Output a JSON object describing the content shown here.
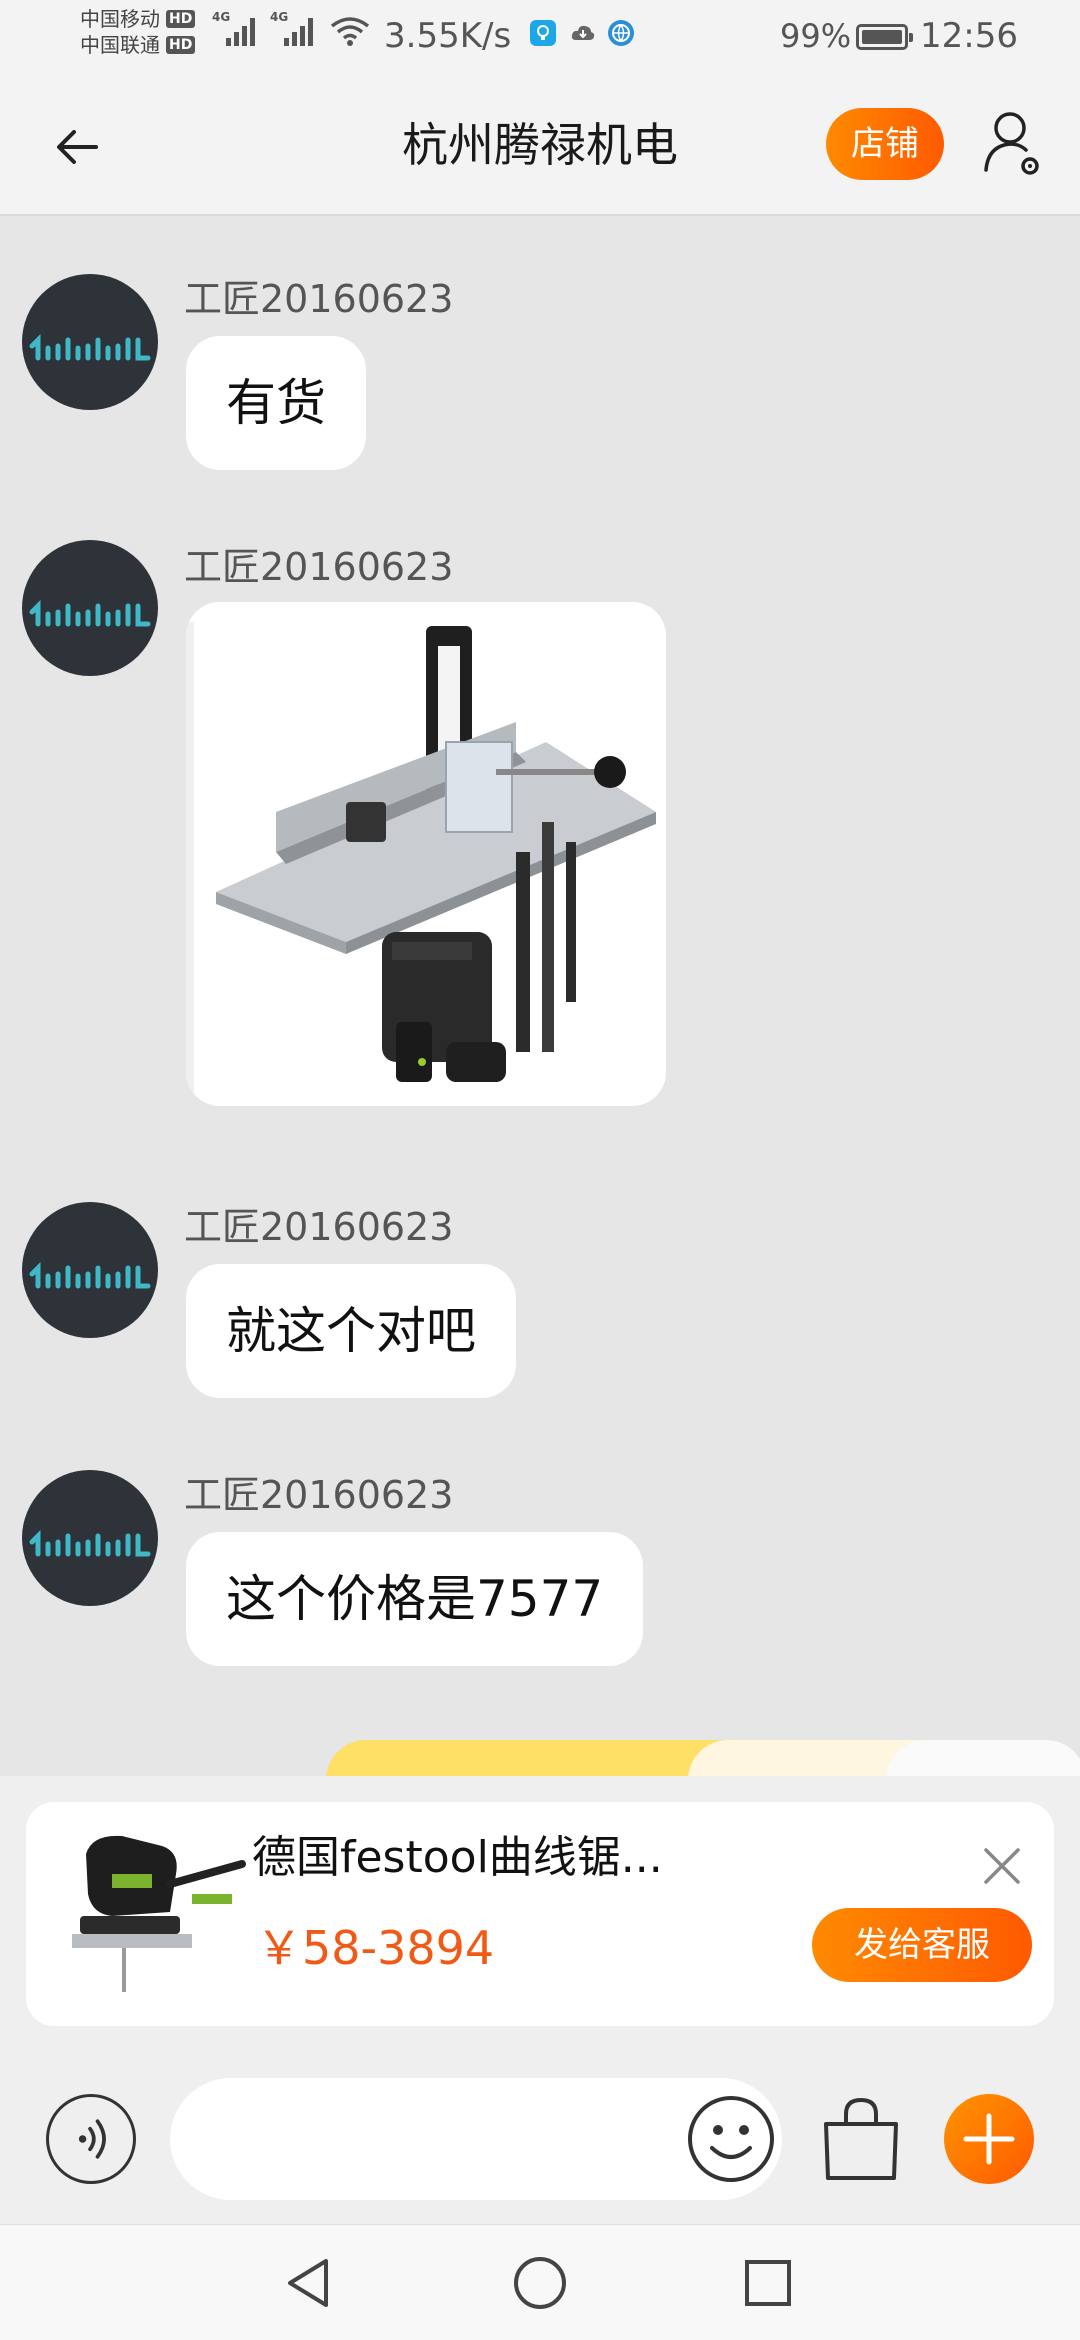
{
  "status_bar": {
    "carrier_1": "中国移动",
    "carrier_2": "中国联通",
    "hd_badge": "HD",
    "network_1": "4G",
    "network_2": "4G",
    "net_speed": "3.55K/s",
    "battery": "99%",
    "time": "12:56"
  },
  "header": {
    "title": "杭州腾禄机电",
    "shop_label": "店铺",
    "back_icon": "arrow-left-icon",
    "profile_icon": "user-settings-icon"
  },
  "messages": [
    {
      "sender": "工匠20160623",
      "type": "text",
      "text": "有货"
    },
    {
      "sender": "工匠20160623",
      "type": "image",
      "image": "router-table-product-photo"
    },
    {
      "sender": "工匠20160623",
      "type": "text",
      "text": "就这个对吧"
    },
    {
      "sender": "工匠20160623",
      "type": "text",
      "text": "这个价格是7577"
    }
  ],
  "product_card": {
    "title": "德国festool曲线锯...",
    "price": "￥58-3894",
    "send_label": "发给客服",
    "close_icon": "close-icon",
    "thumb": "jigsaw-product-thumbnail"
  },
  "input_bar": {
    "placeholder": "",
    "voice_icon": "voice-icon",
    "emoji_icon": "emoji-icon",
    "bag_icon": "shopping-bag-icon",
    "plus_icon": "plus-icon"
  },
  "nav_bar": {
    "back_icon": "triangle-back-icon",
    "home_icon": "circle-home-icon",
    "recents_icon": "square-recents-icon"
  },
  "colors": {
    "accent": "#ff6a00",
    "price": "#f05a16",
    "chat_bg": "#e6e6e6",
    "avatar_bg": "#2d3338",
    "avatar_logo": "#3fb8c8"
  }
}
